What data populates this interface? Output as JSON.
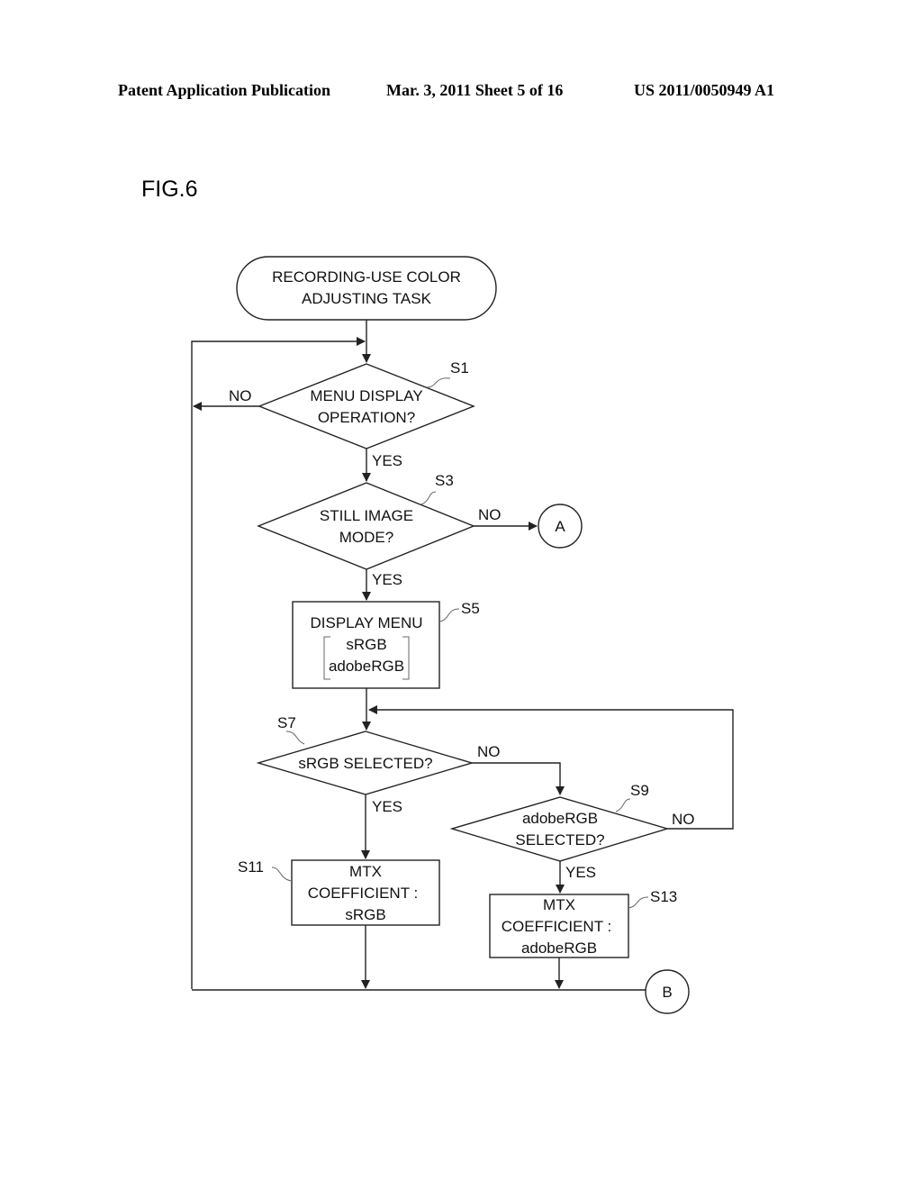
{
  "header": {
    "publication": "Patent Application Publication",
    "date_sheet": "Mar. 3, 2011   Sheet 5 of 16",
    "number": "US 2011/0050949 A1"
  },
  "figure": {
    "label": "FIG.6"
  },
  "flowchart": {
    "start": {
      "line1": "RECORDING-USE COLOR",
      "line2": "ADJUSTING TASK"
    },
    "s1": {
      "tag": "S1",
      "line1": "MENU DISPLAY",
      "line2": "OPERATION?",
      "no": "NO",
      "yes": "YES"
    },
    "s3": {
      "tag": "S3",
      "line1": "STILL IMAGE",
      "line2": "MODE?",
      "no": "NO",
      "yes": "YES"
    },
    "s5": {
      "tag": "S5",
      "line1": "DISPLAY MENU",
      "option1": "sRGB",
      "option2": "adobeRGB"
    },
    "s7": {
      "tag": "S7",
      "line1": "sRGB SELECTED?",
      "no": "NO",
      "yes": "YES"
    },
    "s9": {
      "tag": "S9",
      "line1": "adobeRGB",
      "line2": "SELECTED?",
      "no": "NO",
      "yes": "YES"
    },
    "s11": {
      "tag": "S11",
      "line1": "MTX",
      "line2": "COEFFICIENT :",
      "line3": "sRGB"
    },
    "s13": {
      "tag": "S13",
      "line1": "MTX",
      "line2": "COEFFICIENT :",
      "line3": "adobeRGB"
    },
    "connector_a": "A",
    "connector_b": "B"
  }
}
